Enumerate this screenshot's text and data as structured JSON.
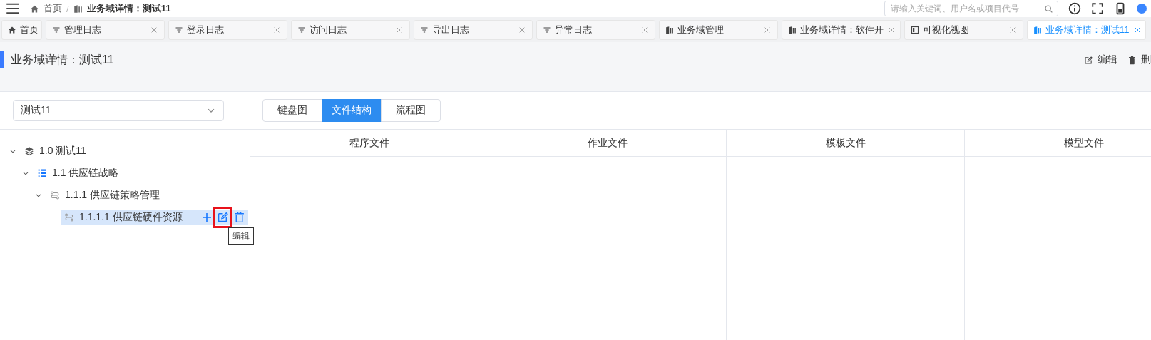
{
  "top_bar": {
    "breadcrumb": [
      {
        "label": "首页",
        "kind": "home"
      },
      {
        "label": "业务域详情：测试11",
        "kind": "building"
      }
    ],
    "separator": "/",
    "search": {
      "placeholder": "请输入关键词、用户名或项目代号"
    }
  },
  "tabs": [
    {
      "label": "首页",
      "kind": "home",
      "closable": false,
      "selected": false
    },
    {
      "label": "管理日志",
      "kind": "filter",
      "closable": true,
      "selected": false
    },
    {
      "label": "登录日志",
      "kind": "filter",
      "closable": true,
      "selected": false
    },
    {
      "label": "访问日志",
      "kind": "filter",
      "closable": true,
      "selected": false
    },
    {
      "label": "导出日志",
      "kind": "filter",
      "closable": true,
      "selected": false
    },
    {
      "label": "异常日志",
      "kind": "filter",
      "closable": true,
      "selected": false
    },
    {
      "label": "业务域管理",
      "kind": "building",
      "closable": true,
      "selected": false
    },
    {
      "label": "业务域详情：软件开",
      "kind": "building",
      "closable": true,
      "selected": false
    },
    {
      "label": "可视化视图",
      "kind": "panel",
      "closable": true,
      "selected": false
    },
    {
      "label": "业务域详情：测试11",
      "kind": "building",
      "closable": true,
      "selected": true
    }
  ],
  "page_header": {
    "title": "业务域详情：测试11",
    "actions": [
      {
        "label": "编辑",
        "kind": "edit"
      },
      {
        "label": "删",
        "kind": "trash"
      }
    ]
  },
  "domain_select": {
    "value": "测试11"
  },
  "tree": [
    {
      "label": "1.0 测试11",
      "kind": "layers",
      "expanded": true,
      "selected": false,
      "children": [
        {
          "label": "1.1 供应链战略",
          "kind": "list",
          "expanded": true,
          "selected": false,
          "children": [
            {
              "label": "1.1.1 供应链策略管理",
              "kind": "flow",
              "expanded": true,
              "selected": false,
              "children": [
                {
                  "label": "1.1.1.1 供应链硬件资源",
                  "kind": "flow",
                  "selected": true,
                  "tooltip": "编辑",
                  "annotated": true
                }
              ]
            }
          ]
        }
      ]
    }
  ],
  "view_tabs": [
    {
      "label": "键盘图",
      "selected": false
    },
    {
      "label": "文件结构",
      "selected": true
    },
    {
      "label": "流程图",
      "selected": false
    }
  ],
  "table": {
    "columns": [
      "程序文件",
      "作业文件",
      "模板文件",
      "模型文件"
    ]
  }
}
